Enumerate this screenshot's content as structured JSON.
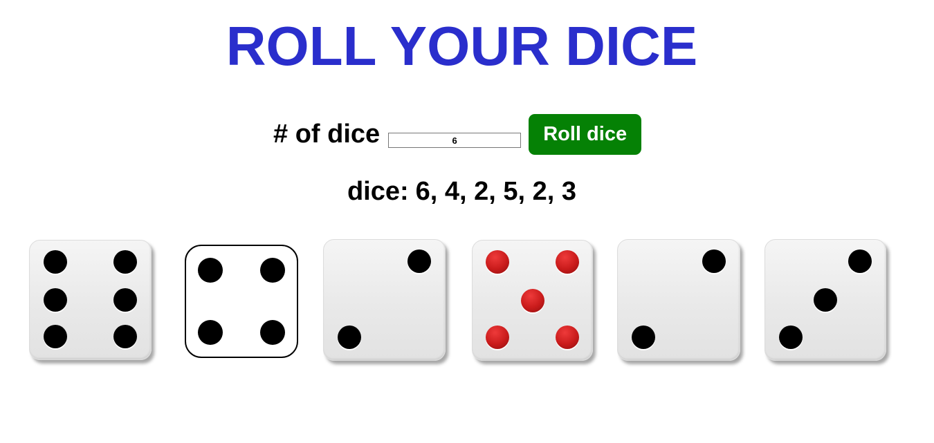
{
  "page": {
    "title": "ROLL YOUR DICE",
    "title_color": "#2a2ecc"
  },
  "controls": {
    "count_label": "# of dice",
    "count_value": "6",
    "roll_button_label": "Roll dice",
    "roll_button_color": "#058105"
  },
  "result": {
    "label": "dice:",
    "values_text": "6, 4, 2, 5, 2, 3"
  },
  "dice": [
    {
      "value": 6,
      "style": "white-shaded",
      "pip_color": "#000000"
    },
    {
      "value": 4,
      "style": "outline",
      "pip_color": "#000000"
    },
    {
      "value": 2,
      "style": "white-shaded",
      "pip_color": "#000000"
    },
    {
      "value": 5,
      "style": "white-shaded",
      "pip_color": "#d21a1a"
    },
    {
      "value": 2,
      "style": "white-shaded",
      "pip_color": "#000000"
    },
    {
      "value": 3,
      "style": "white-shaded",
      "pip_color": "#000000"
    }
  ]
}
